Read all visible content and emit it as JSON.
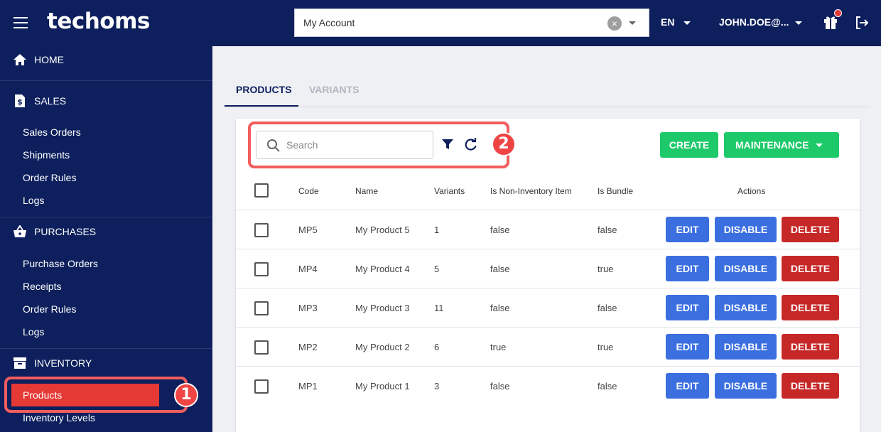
{
  "header": {
    "logo": "techoms",
    "account": "My Account",
    "language": "EN",
    "user": "JOHN.DOE@..."
  },
  "sidebar": {
    "sections": [
      {
        "label": "HOME",
        "icon": "home-icon"
      },
      {
        "label": "SALES",
        "icon": "invoice-icon",
        "items": [
          "Sales Orders",
          "Shipments",
          "Order Rules",
          "Logs"
        ]
      },
      {
        "label": "PURCHASES",
        "icon": "basket-icon",
        "items": [
          "Purchase Orders",
          "Receipts",
          "Order Rules",
          "Logs"
        ]
      },
      {
        "label": "INVENTORY",
        "icon": "archive-icon",
        "items": [
          "Products",
          "Inventory Levels"
        ]
      }
    ],
    "active_item": "Products"
  },
  "annotations": {
    "badge1": "1",
    "badge2": "2",
    "highlight_color": "#f25d5d"
  },
  "tabs": [
    "PRODUCTS",
    "VARIANTS"
  ],
  "toolbar": {
    "search_placeholder": "Search",
    "create_label": "CREATE",
    "maintenance_label": "MAINTENANCE"
  },
  "table": {
    "columns": [
      "Code",
      "Name",
      "Variants",
      "Is Non-Inventory Item",
      "Is Bundle",
      "Actions"
    ],
    "rows": [
      {
        "code": "MP5",
        "name": "My Product 5",
        "variants": "1",
        "non_inventory": "false",
        "bundle": "false"
      },
      {
        "code": "MP4",
        "name": "My Product 4",
        "variants": "5",
        "non_inventory": "false",
        "bundle": "true"
      },
      {
        "code": "MP3",
        "name": "My Product 3",
        "variants": "11",
        "non_inventory": "false",
        "bundle": "false"
      },
      {
        "code": "MP2",
        "name": "My Product 2",
        "variants": "6",
        "non_inventory": "true",
        "bundle": "true"
      },
      {
        "code": "MP1",
        "name": "My Product 1",
        "variants": "3",
        "non_inventory": "false",
        "bundle": "false"
      }
    ],
    "actions": {
      "edit": "EDIT",
      "disable": "DISABLE",
      "delete": "DELETE"
    }
  },
  "colors": {
    "navy": "#0d1f5c",
    "green": "#1ec96a",
    "blue": "#3b6fe0",
    "red": "#c62828",
    "active": "#e53935"
  }
}
